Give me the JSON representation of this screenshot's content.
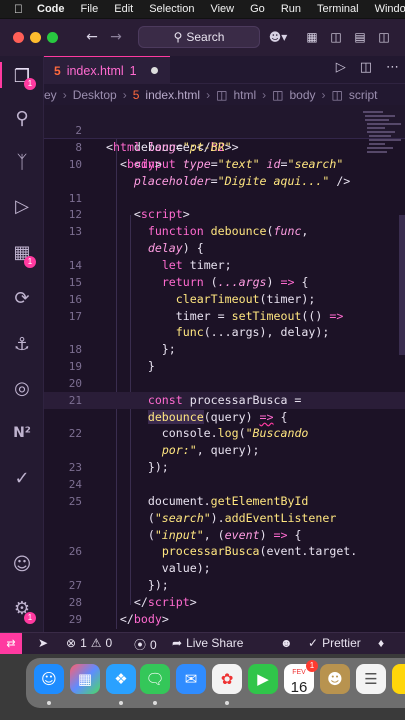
{
  "menubar": {
    "app": "Code",
    "items": [
      "File",
      "Edit",
      "Selection",
      "View",
      "Go",
      "Run",
      "Terminal",
      "Window"
    ]
  },
  "titlebar": {
    "search_label": "Search"
  },
  "tab": {
    "file": "index.html",
    "count": "1"
  },
  "breadcrumb": {
    "items": [
      "ey",
      "Desktop",
      "index.html",
      "html",
      "body",
      "script"
    ]
  },
  "activity_badges": {
    "explorer": "1",
    "extensions": "1",
    "accounts": "1"
  },
  "code": {
    "sticky": [
      {
        "n": "2",
        "t": "html_open"
      },
      {
        "n": "8",
        "t": "body_open"
      }
    ],
    "lines": [
      {
        "n": "",
        "parts": [
          [
            "plain",
            "      debounce:</"
          ],
          [
            "tag",
            "h2"
          ],
          [
            "plain",
            ">"
          ]
        ]
      },
      {
        "n": "10",
        "parts": [
          [
            "plain",
            "      <"
          ],
          [
            "tag",
            "input"
          ],
          [
            "plain",
            " "
          ],
          [
            "attr",
            "type"
          ],
          [
            "plain",
            "="
          ],
          [
            "str",
            "\"text\""
          ],
          [
            "plain",
            " "
          ],
          [
            "attr",
            "id"
          ],
          [
            "plain",
            "="
          ],
          [
            "str",
            "\"search\""
          ]
        ]
      },
      {
        "n": "",
        "parts": [
          [
            "plain",
            "      "
          ],
          [
            "attr",
            "placeholder"
          ],
          [
            "plain",
            "="
          ],
          [
            "str",
            "\"Digite aqui...\""
          ],
          [
            "plain",
            " />"
          ]
        ]
      },
      {
        "n": "11",
        "parts": []
      },
      {
        "n": "12",
        "parts": [
          [
            "plain",
            "      <"
          ],
          [
            "tag",
            "script"
          ],
          [
            "plain",
            ">"
          ]
        ]
      },
      {
        "n": "13",
        "parts": [
          [
            "plain",
            "        "
          ],
          [
            "kw",
            "function"
          ],
          [
            "plain",
            " "
          ],
          [
            "fn",
            "debounce"
          ],
          [
            "plain",
            "("
          ],
          [
            "param",
            "func"
          ],
          [
            "plain",
            ","
          ]
        ]
      },
      {
        "n": "",
        "parts": [
          [
            "plain",
            "        "
          ],
          [
            "param",
            "delay"
          ],
          [
            "plain",
            ") {"
          ]
        ]
      },
      {
        "n": "14",
        "parts": [
          [
            "plain",
            "          "
          ],
          [
            "kw",
            "let"
          ],
          [
            "plain",
            " timer;"
          ]
        ]
      },
      {
        "n": "15",
        "parts": [
          [
            "plain",
            "          "
          ],
          [
            "kw",
            "return"
          ],
          [
            "plain",
            " ("
          ],
          [
            "param",
            "...args"
          ],
          [
            "plain",
            ") "
          ],
          [
            "kw",
            "=>"
          ],
          [
            "plain",
            " {"
          ]
        ]
      },
      {
        "n": "16",
        "parts": [
          [
            "plain",
            "            "
          ],
          [
            "fn",
            "clearTimeout"
          ],
          [
            "plain",
            "(timer);"
          ]
        ]
      },
      {
        "n": "17",
        "parts": [
          [
            "plain",
            "            timer = "
          ],
          [
            "fn",
            "setTimeout"
          ],
          [
            "plain",
            "(() "
          ],
          [
            "kw",
            "=>"
          ]
        ]
      },
      {
        "n": "",
        "parts": [
          [
            "plain",
            "            "
          ],
          [
            "fn",
            "func"
          ],
          [
            "plain",
            "(...args), delay);"
          ]
        ]
      },
      {
        "n": "18",
        "parts": [
          [
            "plain",
            "          };"
          ]
        ]
      },
      {
        "n": "19",
        "parts": [
          [
            "plain",
            "        }"
          ]
        ]
      },
      {
        "n": "20",
        "parts": []
      },
      {
        "n": "21",
        "parts": [
          [
            "plain",
            "        "
          ],
          [
            "kw",
            "const"
          ],
          [
            "plain",
            " processarBusca ="
          ]
        ]
      },
      {
        "n": "",
        "parts": [
          [
            "plain",
            "        "
          ],
          [
            "fn",
            "debounce"
          ],
          [
            "plain",
            "(query) "
          ],
          [
            "kw",
            "=>"
          ],
          [
            "plain",
            " {"
          ]
        ]
      },
      {
        "n": "22",
        "parts": [
          [
            "plain",
            "          console."
          ],
          [
            "fn",
            "log"
          ],
          [
            "plain",
            "("
          ],
          [
            "str",
            "\"Buscando"
          ]
        ]
      },
      {
        "n": "",
        "parts": [
          [
            "plain",
            "          "
          ],
          [
            "str",
            "por:\""
          ],
          [
            "plain",
            ", query);"
          ]
        ]
      },
      {
        "n": "23",
        "parts": [
          [
            "plain",
            "        });"
          ]
        ]
      },
      {
        "n": "24",
        "parts": []
      },
      {
        "n": "25",
        "parts": [
          [
            "plain",
            "        document."
          ],
          [
            "fn",
            "getElementById"
          ]
        ]
      },
      {
        "n": "",
        "parts": [
          [
            "plain",
            "        ("
          ],
          [
            "str",
            "\"search\""
          ],
          [
            "plain",
            ")."
          ],
          [
            "fn",
            "addEventListener"
          ]
        ]
      },
      {
        "n": "",
        "parts": [
          [
            "plain",
            "        ("
          ],
          [
            "str",
            "\"input\""
          ],
          [
            "plain",
            ", ("
          ],
          [
            "param",
            "event"
          ],
          [
            "plain",
            ") "
          ],
          [
            "kw",
            "=>"
          ],
          [
            "plain",
            " {"
          ]
        ]
      },
      {
        "n": "26",
        "parts": [
          [
            "plain",
            "          "
          ],
          [
            "fn",
            "processarBusca"
          ],
          [
            "plain",
            "(event.target."
          ]
        ]
      },
      {
        "n": "",
        "parts": [
          [
            "plain",
            "          value);"
          ]
        ]
      },
      {
        "n": "27",
        "parts": [
          [
            "plain",
            "        });"
          ]
        ]
      },
      {
        "n": "28",
        "parts": [
          [
            "plain",
            "      </"
          ],
          [
            "tag",
            "script"
          ],
          [
            "plain",
            ">"
          ]
        ]
      },
      {
        "n": "29",
        "parts": [
          [
            "plain",
            "    </"
          ],
          [
            "tag",
            "body"
          ],
          [
            "plain",
            ">"
          ]
        ]
      }
    ]
  },
  "status": {
    "errors": "1",
    "warnings": "0",
    "ports": "0",
    "live_share": "Live Share",
    "prettier": "Prettier"
  },
  "dock": {
    "calendar_month": "FEV",
    "calendar_day": "16",
    "calendar_badge": "1"
  },
  "colors": {
    "accent": "#ff3aa0",
    "tag": "#ff6bd0",
    "string": "#ffe680"
  }
}
